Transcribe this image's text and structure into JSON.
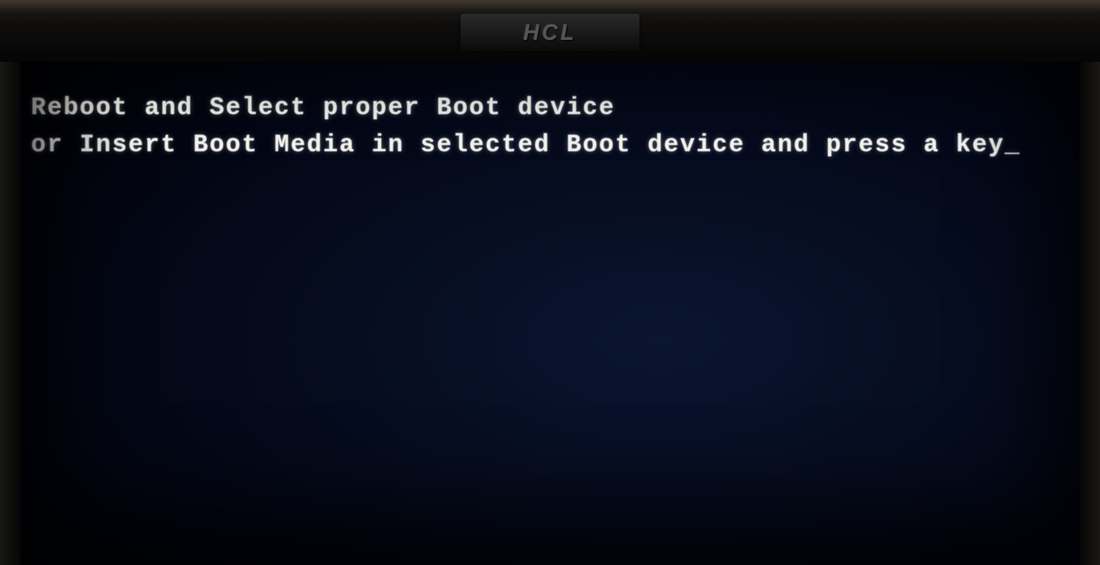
{
  "monitor": {
    "brand_label": "HCL"
  },
  "bios_message": {
    "line1": "Reboot and Select proper Boot device",
    "line2": "or Insert Boot Media in selected Boot device and press a key",
    "cursor": "_"
  }
}
